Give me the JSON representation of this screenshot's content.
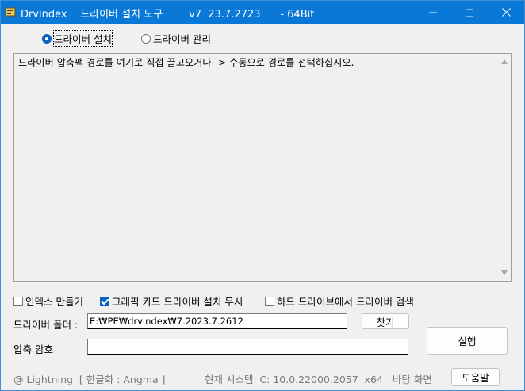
{
  "window": {
    "title": "Drvindex    드라이버 설치 도구        v7  23.7.2723      - 64Bit"
  },
  "mode": {
    "install_label": "드라이버 설치",
    "manage_label": "드라이버 관리",
    "selected": "install"
  },
  "log": {
    "message": "드라이버 압축팩 경로를 여기로 직접 끌고오거나 -> 수동으로 경로를 선택하십시오."
  },
  "options": {
    "make_index": {
      "label": "인덱스 만들기",
      "checked": false
    },
    "ignore_gpu": {
      "label": "그래픽 카드 드라이버 설치 무시",
      "checked": true
    },
    "search_hdd": {
      "label": "하드 드라이브에서 드라이버 검색",
      "checked": false
    }
  },
  "folder": {
    "label": "드라이버 폴더 :",
    "value": "E:₩PE₩drvindex₩7.2023.7.2612",
    "browse_label": "찾기"
  },
  "password": {
    "label": "압축 암호",
    "value": ""
  },
  "run_label": "실행",
  "status": {
    "credit": "@ Lightning  [ 한글화 : Angma ]",
    "system": "현재 시스템  C: 10.0.22000.2057  x64   바탕 화면",
    "help_label": "도움말"
  }
}
